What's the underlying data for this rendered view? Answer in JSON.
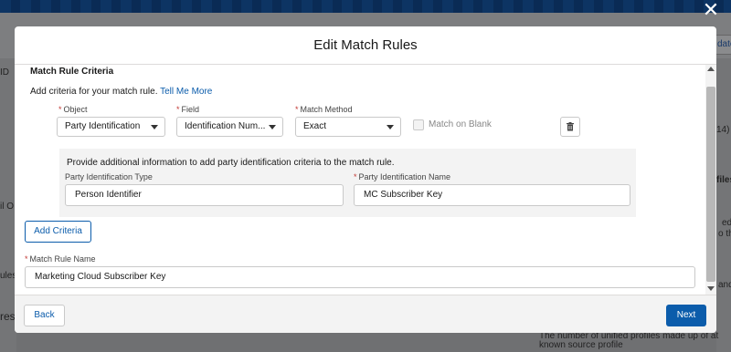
{
  "background": {
    "left_fragments": [
      "ID",
      "il O",
      "ules",
      "res"
    ],
    "right_fragments": [
      "date",
      "14)",
      "files",
      "ed",
      "o th",
      "and"
    ],
    "bottom_text": "The number of unified profiles made up of at known source profile",
    "close_label": "✕"
  },
  "modal": {
    "title": "Edit Match Rules",
    "section_title": "Match Rule Criteria",
    "description": "Add criteria for your match rule.",
    "tell_me_more": "Tell Me More",
    "criteria": {
      "object_label": "Object",
      "object_value": "Party Identification",
      "field_label": "Field",
      "field_value": "Identification Num...",
      "method_label": "Match Method",
      "method_value": "Exact",
      "match_on_blank_label": "Match on Blank",
      "match_on_blank_checked": false
    },
    "info_box": {
      "text": "Provide additional information to add party identification criteria to the match rule.",
      "type_label": "Party Identification Type",
      "type_value": "Person Identifier",
      "name_label": "Party Identification Name",
      "name_value": "MC Subscriber Key"
    },
    "add_criteria_label": "Add Criteria",
    "rule_name_label": "Match Rule Name",
    "rule_name_value": "Marketing Cloud Subscriber Key",
    "back_label": "Back",
    "next_label": "Next"
  },
  "colors": {
    "brand": "#0b5cab",
    "required": "#c23934"
  }
}
